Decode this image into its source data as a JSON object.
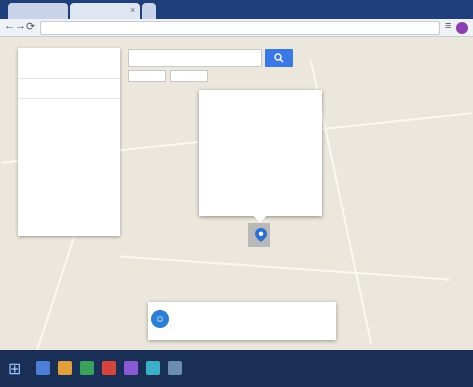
{
  "browser": {
    "tabs": [
      {
        "title": "",
        "close_glyph": "×",
        "active": true
      },
      {
        "title": "",
        "close_glyph": "×",
        "active": false
      }
    ],
    "nav": {
      "back_glyph": "←",
      "forward_glyph": "→",
      "reload_glyph": "⟳"
    },
    "address": {
      "value": "",
      "placeholder": ""
    },
    "menu_glyph": "≡",
    "profile_color": "#8a3fb0"
  },
  "map": {
    "search": {
      "value": "",
      "placeholder": ""
    },
    "search_button_color": "#3a78e8",
    "filter_chips": [
      {
        "label": ""
      },
      {
        "label": ""
      }
    ],
    "sidebar": {
      "title": "",
      "rows": [
        {
          "text": ""
        },
        {
          "text": ""
        },
        {
          "text": ""
        },
        {
          "text": ""
        },
        {
          "text": ""
        },
        {
          "text": ""
        },
        {
          "text": ""
        }
      ]
    },
    "info_card": {
      "title": "",
      "lines": [
        {
          "label": "",
          "value": ""
        },
        {
          "label": "",
          "value": ""
        },
        {
          "label": "",
          "value": ""
        },
        {
          "label": "",
          "value": ""
        },
        {
          "label": "",
          "value": ""
        }
      ]
    },
    "pin_color": "#2b6fd6",
    "bottom_card": {
      "title": "",
      "subtitle": "",
      "avatar_glyph": "☺"
    },
    "labels": [
      "",
      "",
      "",
      "",
      "",
      "",
      "",
      ""
    ]
  },
  "taskbar": {
    "start_glyph": "⊞",
    "icon_colors": [
      "#4a7fd6",
      "#e0a13a",
      "#3aa35a",
      "#d6453a",
      "#8a5ad6",
      "#3ab0c9",
      "#6a8fb0"
    ],
    "clock": ""
  }
}
